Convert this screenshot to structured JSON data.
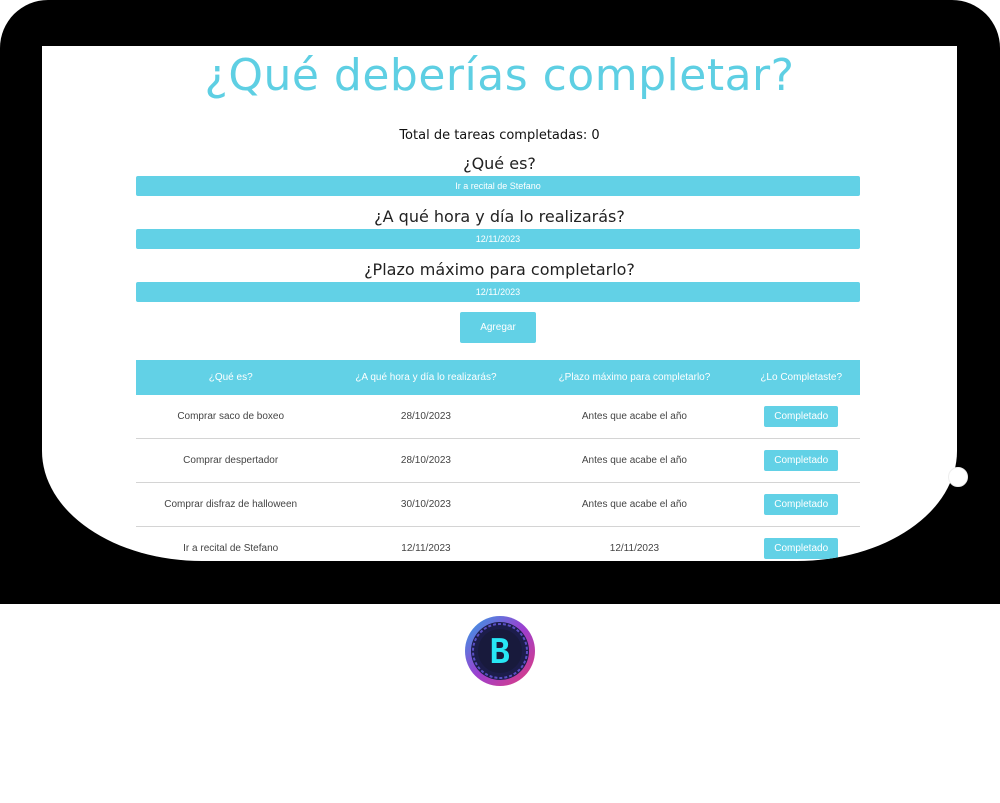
{
  "app": {
    "title": "¿Qué deberías completar?",
    "total_label": "Total de tareas completadas: 0"
  },
  "form": {
    "what_label": "¿Qué es?",
    "what_value": "Ir a recital de Stefano",
    "when_label": "¿A qué hora y día lo realizarás?",
    "when_value": "12/11/2023",
    "deadline_label": "¿Plazo máximo para completarlo?",
    "deadline_value": "12/11/2023",
    "add_label": "Agregar"
  },
  "table": {
    "headers": [
      "¿Qué es?",
      "¿A qué hora y día lo realizarás?",
      "¿Plazo máximo para completarlo?",
      "¿Lo Completaste?"
    ],
    "rows": [
      {
        "what": "Comprar saco de boxeo",
        "when": "28/10/2023",
        "deadline": "Antes que acabe el año",
        "action": "Completado"
      },
      {
        "what": "Comprar despertador",
        "when": "28/10/2023",
        "deadline": "Antes que acabe el año",
        "action": "Completado"
      },
      {
        "what": "Comprar disfraz de halloween",
        "when": "30/10/2023",
        "deadline": "Antes que acabe el año",
        "action": "Completado"
      },
      {
        "what": "Ir a recital de Stefano",
        "when": "12/11/2023",
        "deadline": "12/11/2023",
        "action": "Completado"
      }
    ]
  },
  "colors": {
    "accent": "#62d1e6",
    "bezel": "#000000"
  },
  "logo": {
    "letter": "B",
    "icon": "brand-logo-icon"
  }
}
